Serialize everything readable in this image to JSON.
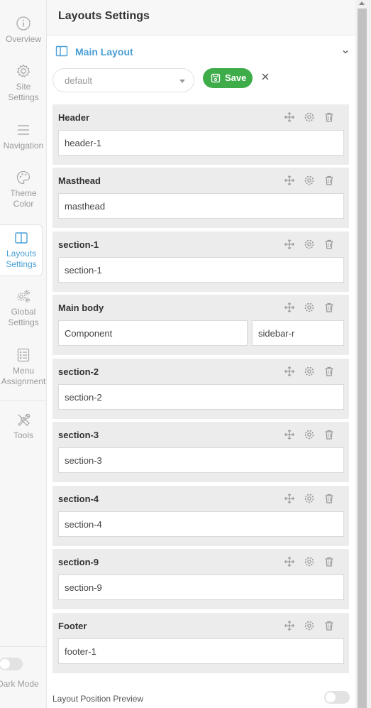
{
  "nav": {
    "items": [
      {
        "label": "Overview",
        "icon": "info-icon"
      },
      {
        "label": "Site\nSettings",
        "icon": "gear-icon"
      },
      {
        "label": "Navigation",
        "icon": "menu-icon"
      },
      {
        "label": "Theme\nColor",
        "icon": "palette-icon"
      },
      {
        "label": "Layouts\nSettings",
        "icon": "layout-icon",
        "active": true
      },
      {
        "label": "Global\nSettings",
        "icon": "gears-icon"
      },
      {
        "label": "Menu\nAssignment",
        "icon": "list-icon"
      },
      {
        "label": "Tools",
        "icon": "tools-icon"
      }
    ],
    "dark_mode_label": "Dark Mode"
  },
  "panel": {
    "title": "Layouts Settings",
    "layout_title": "Main Layout",
    "layout_select_value": "default",
    "save_label": "Save",
    "preview_label": "Layout Position Preview"
  },
  "sections": [
    {
      "title": "Header",
      "positions": [
        "header-1"
      ]
    },
    {
      "title": "Masthead",
      "positions": [
        "masthead"
      ]
    },
    {
      "title": "section-1",
      "positions": [
        "section-1"
      ]
    },
    {
      "title": "Main body",
      "positions": [
        "Component",
        "sidebar-r"
      ]
    },
    {
      "title": "section-2",
      "positions": [
        "section-2"
      ]
    },
    {
      "title": "section-3",
      "positions": [
        "section-3"
      ]
    },
    {
      "title": "section-4",
      "positions": [
        "section-4"
      ]
    },
    {
      "title": "section-9",
      "positions": [
        "section-9"
      ]
    },
    {
      "title": "Footer",
      "positions": [
        "footer-1"
      ]
    }
  ],
  "colors": {
    "accent": "#4a9fd6",
    "save": "#3fac4a",
    "section_bg": "#ececec"
  }
}
